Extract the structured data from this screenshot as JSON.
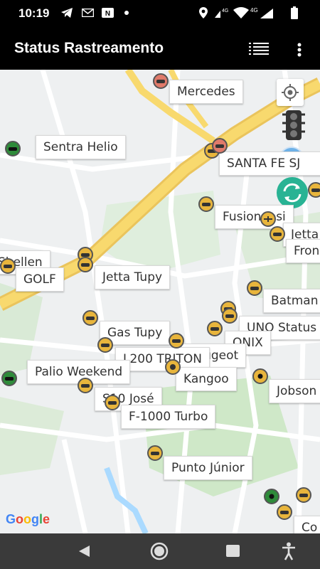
{
  "status_bar": {
    "time": "10:19",
    "icons": [
      "telegram-icon",
      "gmail-icon",
      "nu-icon",
      "dot-icon",
      "location-icon",
      "volte-4g-icon",
      "wifi-icon",
      "signal-4g-icon",
      "battery-icon"
    ]
  },
  "app_bar": {
    "title": "Status Rastreamento",
    "list_icon": "list-icon",
    "menu_icon": "more-vert-icon"
  },
  "map": {
    "vehicles": [
      {
        "name": "Mercedes",
        "type": "red"
      },
      {
        "name": "Sentra Helio",
        "type": "green"
      },
      {
        "name": "SANTA FE SJ",
        "type": "car"
      },
      {
        "name": "Fusion Josi",
        "type": "car"
      },
      {
        "name": "Jetta",
        "type": "car"
      },
      {
        "name": "Fron",
        "type": "car"
      },
      {
        "name": "Shellen",
        "type": "car"
      },
      {
        "name": "GOLF",
        "type": "car"
      },
      {
        "name": "Jetta Tupy",
        "type": "car"
      },
      {
        "name": "Batman",
        "type": "car"
      },
      {
        "name": "UNO Status",
        "type": "car"
      },
      {
        "name": "Gas Tupy",
        "type": "car"
      },
      {
        "name": "ONIX",
        "type": "car"
      },
      {
        "name": "Peugeot",
        "type": "car"
      },
      {
        "name": "L200 TRITON",
        "type": "car"
      },
      {
        "name": "Palio Weekend",
        "type": "green"
      },
      {
        "name": "Kangoo",
        "type": "car"
      },
      {
        "name": "Jobson",
        "type": "car"
      },
      {
        "name": "S10 José",
        "type": "car"
      },
      {
        "name": "F-1000 Turbo",
        "type": "car"
      },
      {
        "name": "Punto Júnior",
        "type": "car"
      },
      {
        "name": "Co",
        "type": "car"
      }
    ],
    "controls": [
      "my-location-icon",
      "traffic-icon",
      "globe-icon",
      "refresh-icon"
    ],
    "attribution": "Google",
    "colors": {
      "road_main": "#f6d36b",
      "water": "#aadaff",
      "park": "#cfe8c8",
      "car_pin": "#e8b53c",
      "refresh": "#29b394"
    }
  },
  "nav_bar": {
    "back": "back-icon",
    "home": "home-icon",
    "recents": "recents-icon",
    "accessibility": "accessibility-icon"
  }
}
